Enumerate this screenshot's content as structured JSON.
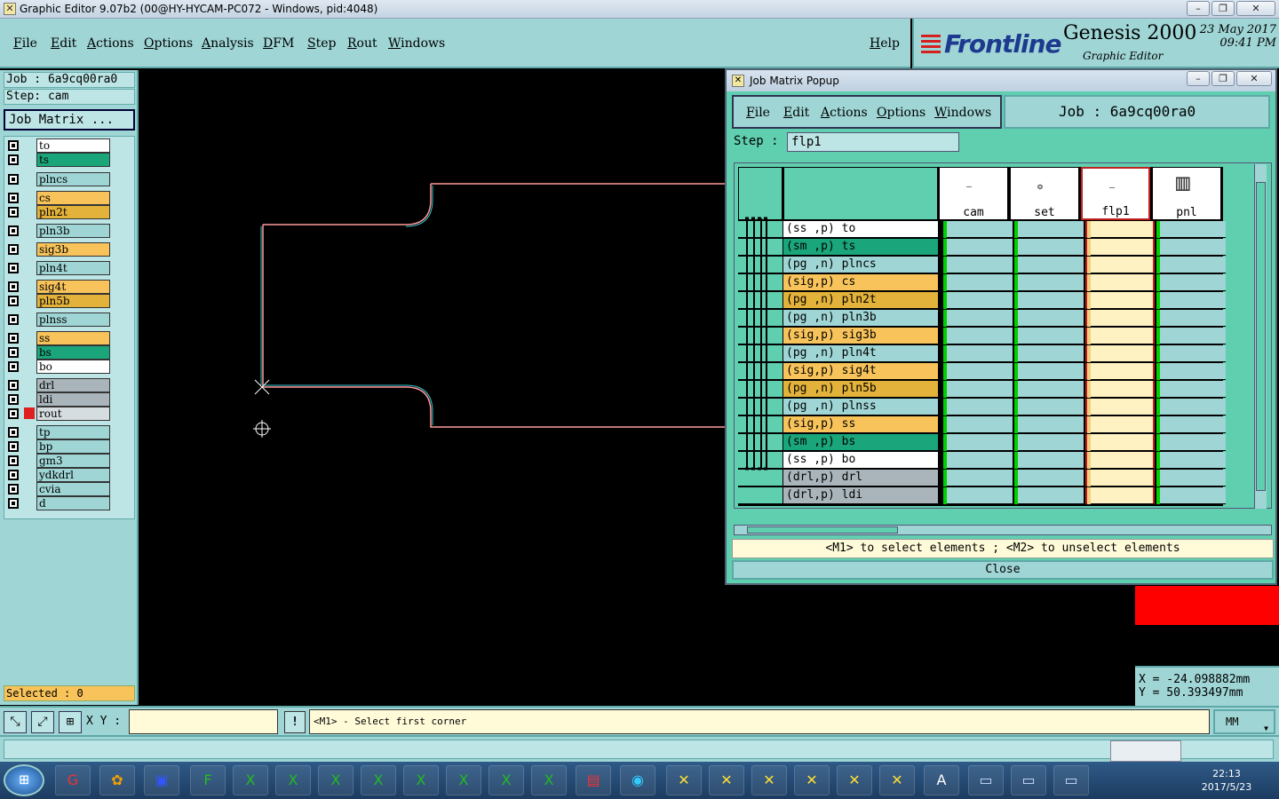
{
  "window": {
    "title": "Graphic Editor 9.07b2 (00@HY-HYCAM-PC072 - Windows, pid:4048)"
  },
  "menu": [
    "File",
    "Edit",
    "Actions",
    "Options",
    "Analysis",
    "DFM",
    "Step",
    "Rout",
    "Windows"
  ],
  "help_label": "Help",
  "brand": {
    "logo": "Frontline",
    "product": "Genesis 2000",
    "subtitle": "Graphic Editor",
    "date": "23 May 2017",
    "time": "09:41 PM"
  },
  "left_panel": {
    "job": "Job : 6a9cq00ra0",
    "step": "Step: cam",
    "job_matrix_button": "Job Matrix ...",
    "layers": [
      {
        "name": "to",
        "color": "#ffffff"
      },
      {
        "name": "ts",
        "color": "#1aa67a"
      },
      {
        "name": "plncs",
        "color": "#9fd5d5"
      },
      {
        "name": "cs",
        "color": "#f7c35a"
      },
      {
        "name": "pln2t",
        "color": "#e3b23a"
      },
      {
        "name": "pln3b",
        "color": "#9fd5d5"
      },
      {
        "name": "sig3b",
        "color": "#f7c35a"
      },
      {
        "name": "pln4t",
        "color": "#9fd5d5"
      },
      {
        "name": "sig4t",
        "color": "#f7c35a"
      },
      {
        "name": "pln5b",
        "color": "#e3b23a"
      },
      {
        "name": "plnss",
        "color": "#9fd5d5"
      },
      {
        "name": "ss",
        "color": "#f7c35a"
      },
      {
        "name": "bs",
        "color": "#1aa67a"
      },
      {
        "name": "bo",
        "color": "#ffffff"
      },
      {
        "name": "drl",
        "color": "#a9b5bb"
      },
      {
        "name": "ldi",
        "color": "#a9b5bb"
      },
      {
        "name": "rout",
        "color": "#d6dde0"
      },
      {
        "name": "tp",
        "color": "#9fd5d5"
      },
      {
        "name": "bp",
        "color": "#9fd5d5"
      },
      {
        "name": "gm3",
        "color": "#9fd5d5"
      },
      {
        "name": "ydkdrl",
        "color": "#9fd5d5"
      },
      {
        "name": "cvia",
        "color": "#9fd5d5"
      },
      {
        "name": "d",
        "color": "#9fd5d5"
      }
    ],
    "selected": "Selected : 0"
  },
  "coords": {
    "x": "X = -24.098882mm",
    "y": "Y = 50.393497mm"
  },
  "command_bar": {
    "xy_label": "X Y :",
    "xy_value": "",
    "excl": "!",
    "prompt": "<M1> - Select first corner",
    "unit": "MM"
  },
  "popup": {
    "title": "Job Matrix Popup",
    "menu": [
      "File",
      "Edit",
      "Actions",
      "Options",
      "Windows"
    ],
    "job": "Job : 6a9cq00ra0",
    "step_label": "Step :",
    "step_value": "flp1",
    "steps": [
      "cam",
      "set",
      "flp1",
      "pnl"
    ],
    "rows": [
      {
        "label": "(ss ,p) to",
        "color": "#ffffff"
      },
      {
        "label": "(sm ,p) ts",
        "color": "#1aa67a"
      },
      {
        "label": "(pg ,n) plncs",
        "color": "#9fd5d5"
      },
      {
        "label": "(sig,p) cs",
        "color": "#f7c35a"
      },
      {
        "label": "(pg ,n) pln2t",
        "color": "#e3b23a"
      },
      {
        "label": "(pg ,n) pln3b",
        "color": "#9fd5d5"
      },
      {
        "label": "(sig,p) sig3b",
        "color": "#f7c35a"
      },
      {
        "label": "(pg ,n) pln4t",
        "color": "#9fd5d5"
      },
      {
        "label": "(sig,p) sig4t",
        "color": "#f7c35a"
      },
      {
        "label": "(pg ,n) pln5b",
        "color": "#e3b23a"
      },
      {
        "label": "(pg ,n) plnss",
        "color": "#9fd5d5"
      },
      {
        "label": "(sig,p) ss",
        "color": "#f7c35a"
      },
      {
        "label": "(sm ,p) bs",
        "color": "#1aa67a"
      },
      {
        "label": "(ss ,p) bo",
        "color": "#ffffff"
      },
      {
        "label": "(drl,p) drl",
        "color": "#a9b5bb"
      },
      {
        "label": "(drl,p) ldi",
        "color": "#a9b5bb"
      }
    ],
    "hint": "<M1> to select elements ; <M2> to unselect elements",
    "close_label": "Close"
  },
  "taskbar": {
    "clock_time": "22:13",
    "clock_date": "2017/5/23"
  }
}
